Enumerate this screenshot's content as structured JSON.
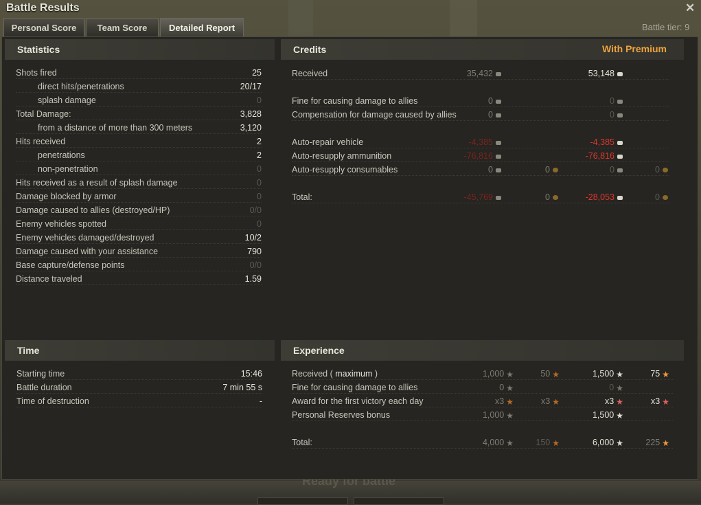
{
  "window": {
    "title": "Battle Results",
    "battle_tier": "Battle tier: 9"
  },
  "tabs": [
    {
      "label": "Personal Score",
      "active": false
    },
    {
      "label": "Team Score",
      "active": false
    },
    {
      "label": "Detailed Report",
      "active": true
    }
  ],
  "statistics": {
    "header": "Statistics",
    "rows": [
      {
        "label": "Shots fired",
        "value": "25"
      },
      {
        "label": "direct hits/penetrations",
        "value": "20/17"
      },
      {
        "label": "splash damage",
        "value": "0"
      },
      {
        "label": "Total Damage:",
        "value": "3,828"
      },
      {
        "label": "from a distance of more than 300 meters",
        "value": "3,120"
      },
      {
        "label": "Hits received",
        "value": "2"
      },
      {
        "label": "penetrations",
        "value": "2"
      },
      {
        "label": "non-penetration",
        "value": "0"
      },
      {
        "label": "Hits received as a result of splash damage",
        "value": "0"
      },
      {
        "label": "Damage blocked by armor",
        "value": "0"
      },
      {
        "label": "Damage caused to allies (destroyed/HP)",
        "value": "0/0"
      },
      {
        "label": "Enemy vehicles spotted",
        "value": "0"
      },
      {
        "label": "Enemy vehicles damaged/destroyed",
        "value": "10/2"
      },
      {
        "label": "Damage caused with your assistance",
        "value": "790"
      },
      {
        "label": "Base capture/defense points",
        "value": "0/0"
      },
      {
        "label": "Distance traveled",
        "value": "1.59"
      }
    ]
  },
  "credits": {
    "header": "Credits",
    "premium_label": "With Premium",
    "rows": [
      {
        "label": "Received",
        "std": "35,432",
        "prem": "53,148"
      },
      {
        "label": "Fine for causing damage to allies",
        "std": "0",
        "prem": "0"
      },
      {
        "label": "Compensation for damage caused by allies",
        "std": "0",
        "prem": "0"
      },
      {
        "label": "Auto-repair vehicle",
        "std": "-4,385",
        "prem": "-4,385"
      },
      {
        "label": "Auto-resupply ammunition",
        "std": "-76,816",
        "prem": "-76,816"
      },
      {
        "label": "Auto-resupply consumables",
        "std": "0",
        "std_gold": "0",
        "prem": "0",
        "prem_gold": "0"
      },
      {
        "label": "Total:",
        "std": "-45,769",
        "std_gold": "0",
        "prem": "-28,053",
        "prem_gold": "0"
      }
    ]
  },
  "time": {
    "header": "Time",
    "rows": [
      {
        "label": "Starting time",
        "value": "15:46"
      },
      {
        "label": "Battle duration",
        "value": "7 min 55 s"
      },
      {
        "label": "Time of destruction",
        "value": "-"
      }
    ]
  },
  "experience": {
    "header": "Experience",
    "received_prefix": "Received (",
    "received_keyword": "maximum",
    "received_suffix": ")",
    "rows": [
      {
        "label": "Fine for causing damage to allies",
        "std": "0",
        "prem": "0"
      },
      {
        "label": "Award for the first victory each day",
        "std": "x3",
        "std_free": "x3",
        "prem": "x3",
        "prem_free": "x3"
      },
      {
        "label": "Personal Reserves bonus",
        "std": "1,000",
        "prem": "1,500"
      },
      {
        "label": "Total:",
        "std": "4,000",
        "std_free": "150",
        "prem": "6,000",
        "prem_free": "225"
      }
    ],
    "received": {
      "std": "1,000",
      "std_free": "50",
      "prem": "1,500",
      "prem_free": "75"
    }
  },
  "background": {
    "ghost_text": "Ready for battle"
  },
  "icons": {
    "close": "close-icon",
    "credit": "credit-coin-icon",
    "gold": "gold-coin-icon",
    "xp": "xp-star-icon",
    "free_xp": "free-xp-star-icon"
  },
  "colors": {
    "premium": "#f0a33c",
    "negative": "#e0352b",
    "panel": "#262521"
  }
}
